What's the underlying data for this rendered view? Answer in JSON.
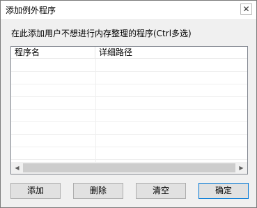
{
  "window": {
    "title": "添加例外程序",
    "close_glyph": "✕"
  },
  "instruction": "在此添加用户不想进行内存整理的程序(Ctrl多选)",
  "list": {
    "columns": [
      "程序名",
      "详细路径"
    ],
    "rows": []
  },
  "scrollbar": {
    "left_arrow": "◀",
    "right_arrow": "▶"
  },
  "buttons": {
    "add": "添加",
    "delete": "删除",
    "clear": "清空",
    "ok": "确定"
  }
}
